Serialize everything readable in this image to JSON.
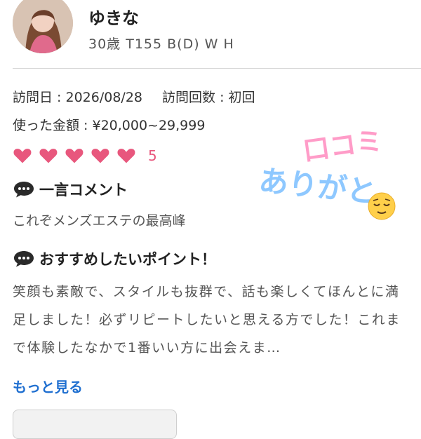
{
  "profile": {
    "name": "ゆきな",
    "stats": "30歳  T155  B(D)  W  H"
  },
  "visit": {
    "date_text": "訪問日 : 2026/08/28",
    "count_text": "訪問回数 : 初回",
    "amount_text": "使った金額 : ¥20,000~29,999"
  },
  "rating": {
    "value": "5",
    "hearts": 5,
    "color": "#e8577d"
  },
  "sections": {
    "comment_title": "一言コメント",
    "comment": "これぞメンズエステの最高峰",
    "points_title": "おすすめしたいポイント！",
    "points_body": "笑顔も素敵で、スタイルも抜群で、話も楽しくてほんとに満足しました！必ずリピートしたいと思える方でした！これまで体験したなかで1番いい方に出会えま…"
  },
  "more_link": "もっと見る",
  "sticker": {
    "line1": "口コミ",
    "line2": "ありがと"
  },
  "icons": {
    "speech": "speech-bubble-icon",
    "heart": "heart-icon",
    "smile": "relieved-face-icon"
  },
  "colors": {
    "link": "#1f6fd0",
    "heart": "#e8577d"
  }
}
